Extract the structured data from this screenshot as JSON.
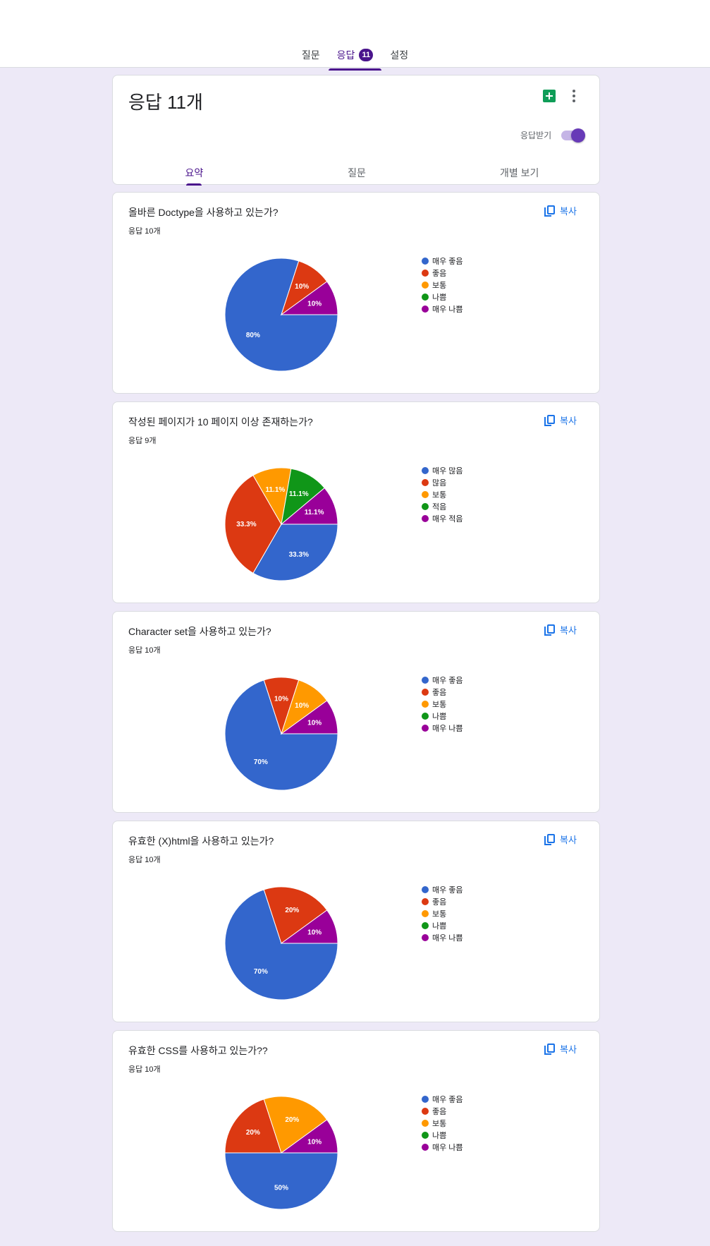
{
  "top_tabs": [
    {
      "label": "질문"
    },
    {
      "label": "응답",
      "badge": "11"
    },
    {
      "label": "설정"
    }
  ],
  "summary": {
    "title": "응답 11개",
    "accepting_label": "응답받기",
    "accepting": true,
    "sub_tabs": [
      "요약",
      "질문",
      "개별 보기"
    ]
  },
  "copy_label": "복사",
  "colors": [
    "#3366cc",
    "#dc3912",
    "#ff9900",
    "#109618",
    "#990099"
  ],
  "questions": [
    {
      "title": "올바른 Doctype을 사용하고 있는가?",
      "count": "응답 10개",
      "legend": [
        "매우 좋음",
        "좋음",
        "보통",
        "나쁨",
        "매우 나쁨"
      ]
    },
    {
      "title": "작성된 페이지가 10 페이지 이상 존재하는가?",
      "count": "응답 9개",
      "legend": [
        "매우 많음",
        "많음",
        "보통",
        "적음",
        "매우 적음"
      ]
    },
    {
      "title": "Character set을 사용하고 있는가?",
      "count": "응답 10개",
      "legend": [
        "매우 좋음",
        "좋음",
        "보통",
        "나쁨",
        "매우 나쁨"
      ]
    },
    {
      "title": "유효한 (X)html을 사용하고 있는가?",
      "count": "응답 10개",
      "legend": [
        "매우 좋음",
        "좋음",
        "보통",
        "나쁨",
        "매우 나쁨"
      ]
    },
    {
      "title": "유효한 CSS를 사용하고 있는가??",
      "count": "응답 10개",
      "legend": [
        "매우 좋음",
        "좋음",
        "보통",
        "나쁨",
        "매우 나쁨"
      ]
    }
  ],
  "chart_data": [
    {
      "type": "pie",
      "title": "올바른 Doctype을 사용하고 있는가?",
      "categories": [
        "매우 좋음",
        "좋음",
        "보통",
        "나쁨",
        "매우 나쁨"
      ],
      "values": [
        80,
        10,
        0,
        0,
        10
      ],
      "labels": [
        "80%",
        "10%",
        "",
        "",
        "10%"
      ]
    },
    {
      "type": "pie",
      "title": "작성된 페이지가 10 페이지 이상 존재하는가?",
      "categories": [
        "매우 많음",
        "많음",
        "보통",
        "적음",
        "매우 적음"
      ],
      "values": [
        33.3,
        33.3,
        11.1,
        11.1,
        11.1
      ],
      "labels": [
        "33.3%",
        "33.3%",
        "11.1%",
        "11.1%",
        "11.1%"
      ]
    },
    {
      "type": "pie",
      "title": "Character set을 사용하고 있는가?",
      "categories": [
        "매우 좋음",
        "좋음",
        "보통",
        "나쁨",
        "매우 나쁨"
      ],
      "values": [
        70,
        10,
        10,
        0,
        10
      ],
      "labels": [
        "70%",
        "10%",
        "10%",
        "",
        "10%"
      ]
    },
    {
      "type": "pie",
      "title": "유효한 (X)html을 사용하고 있는가?",
      "categories": [
        "매우 좋음",
        "좋음",
        "보통",
        "나쁨",
        "매우 나쁨"
      ],
      "values": [
        70,
        20,
        0,
        0,
        10
      ],
      "labels": [
        "70%",
        "20%",
        "",
        "",
        "10%"
      ]
    },
    {
      "type": "pie",
      "title": "유효한 CSS를 사용하고 있는가??",
      "categories": [
        "매우 좋음",
        "좋음",
        "보통",
        "나쁨",
        "매우 나쁨"
      ],
      "values": [
        50,
        20,
        20,
        0,
        10
      ],
      "labels": [
        "50%",
        "20%",
        "20%",
        "",
        "10%"
      ]
    }
  ]
}
